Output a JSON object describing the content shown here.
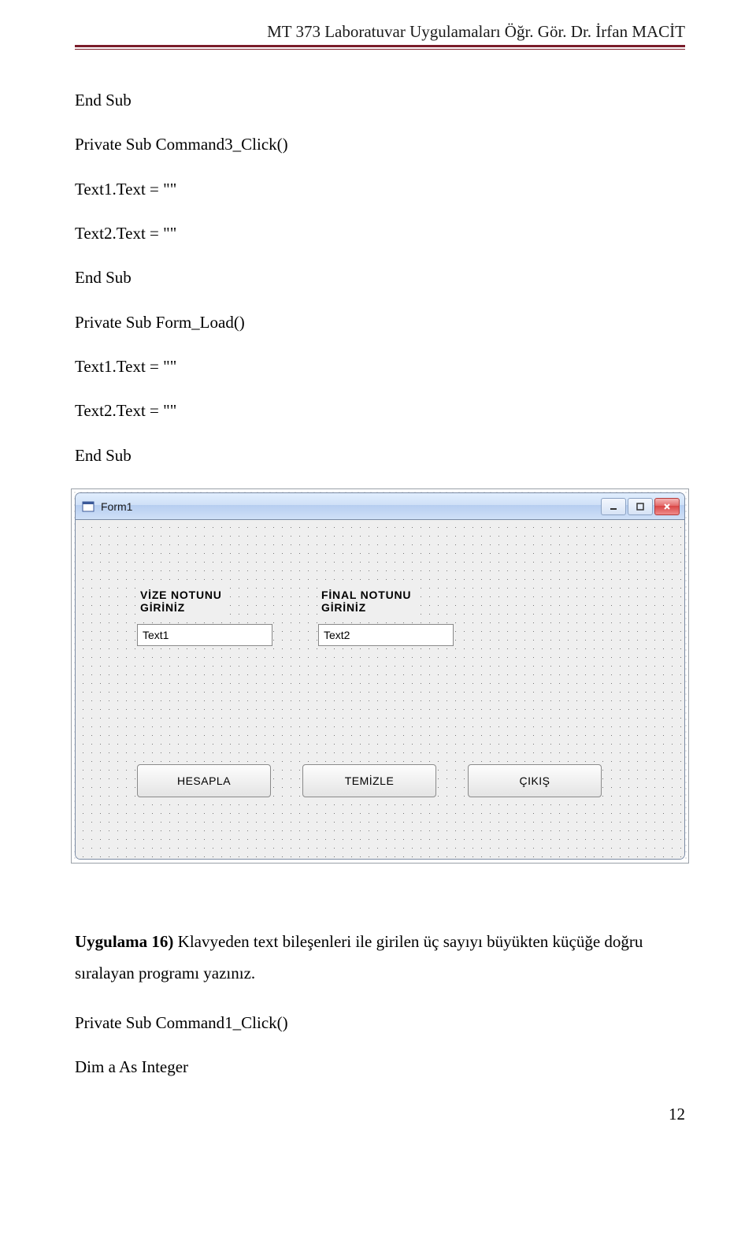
{
  "header": "MT 373 Laboratuvar Uygulamaları Öğr. Gör. Dr. İrfan MACİT",
  "code": {
    "lines1": [
      "End Sub",
      "Private Sub Command3_Click()",
      "Text1.Text = \"\"",
      "Text2.Text = \"\"",
      "End Sub",
      "Private Sub Form_Load()",
      "Text1.Text = \"\"",
      "Text2.Text = \"\"",
      "End Sub"
    ],
    "lines2": [
      "Private Sub Command1_Click()",
      "Dim a As Integer"
    ]
  },
  "form": {
    "title": "Form1",
    "label1": "VİZE NOTUNU\nGİRİNİZ",
    "label2": "FİNAL NOTUNU\nGİRİNİZ",
    "text1": "Text1",
    "text2": "Text2",
    "btn1": "HESAPLA",
    "btn2": "TEMİZLE",
    "btn3": "ÇIKIŞ"
  },
  "exercise": {
    "title": "Uygulama 16)",
    "body": " Klavyeden text bileşenleri ile girilen üç sayıyı büyükten küçüğe doğru sıralayan programı yazınız."
  },
  "page_number": "12"
}
